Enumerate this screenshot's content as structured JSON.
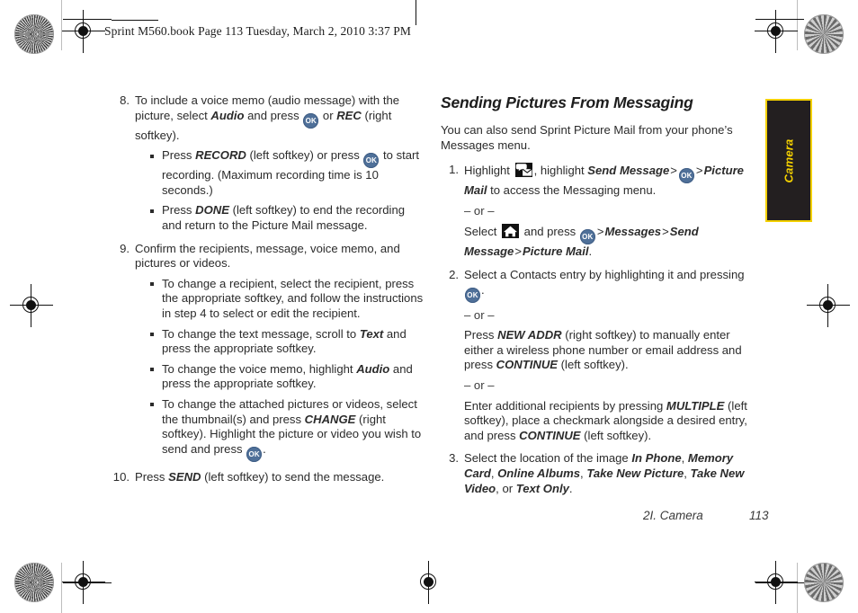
{
  "document": {
    "header_line": "Sprint M560.book  Page 113  Tuesday, March 2, 2010  3:37 PM",
    "footer_chapter": "2I. Camera",
    "footer_page": "113",
    "thumb_tab_label": "Camera",
    "accent_yellow": "#f3d000",
    "tab_background": "#231f20",
    "ok_key_color": "#4f7099"
  },
  "left_column": {
    "steps": [
      {
        "number": "8.",
        "segments": [
          {
            "t": "text",
            "v": "To include a voice memo (audio message) with the picture, select "
          },
          {
            "t": "kw",
            "v": "Audio"
          },
          {
            "t": "text",
            "v": " and press "
          },
          {
            "t": "okkey",
            "v": "OK"
          },
          {
            "t": "text",
            "v": " or "
          },
          {
            "t": "kw",
            "v": "REC"
          },
          {
            "t": "text",
            "v": " (right softkey)."
          }
        ],
        "bullets": [
          [
            {
              "t": "text",
              "v": "Press "
            },
            {
              "t": "kw",
              "v": "RECORD"
            },
            {
              "t": "text",
              "v": " (left softkey) or press "
            },
            {
              "t": "okkey",
              "v": "OK"
            },
            {
              "t": "text",
              "v": " to start recording. (Maximum recording time is 10 seconds.)"
            }
          ],
          [
            {
              "t": "text",
              "v": "Press "
            },
            {
              "t": "kw",
              "v": "DONE"
            },
            {
              "t": "text",
              "v": " (left softkey) to end the recording and return to the Picture Mail message."
            }
          ]
        ]
      },
      {
        "number": "9.",
        "segments": [
          {
            "t": "text",
            "v": "Confirm the recipients, message, voice memo, and pictures or videos."
          }
        ],
        "bullets": [
          [
            {
              "t": "text",
              "v": "To change a recipient, select the recipient, press the appropriate softkey, and follow the instructions in step 4 to select or edit the recipient."
            }
          ],
          [
            {
              "t": "text",
              "v": "To change the text message, scroll to "
            },
            {
              "t": "kw",
              "v": "Text"
            },
            {
              "t": "text",
              "v": " and press the appropriate softkey."
            }
          ],
          [
            {
              "t": "text",
              "v": "To change the voice memo, highlight "
            },
            {
              "t": "kw",
              "v": "Audio"
            },
            {
              "t": "text",
              "v": " and press the appropriate softkey."
            }
          ],
          [
            {
              "t": "text",
              "v": "To change the attached pictures or videos, select the thumbnail(s) and press "
            },
            {
              "t": "kw",
              "v": "CHANGE"
            },
            {
              "t": "text",
              "v": " (right softkey). Highlight the picture or video you wish to send and press "
            },
            {
              "t": "okkey",
              "v": "OK"
            },
            {
              "t": "text",
              "v": "."
            }
          ]
        ]
      },
      {
        "number": "10.",
        "segments": [
          {
            "t": "text",
            "v": "Press "
          },
          {
            "t": "kw",
            "v": "SEND"
          },
          {
            "t": "text",
            "v": " (left softkey) to send the message."
          }
        ],
        "bullets": []
      }
    ]
  },
  "right_column": {
    "section_title": "Sending Pictures From Messaging",
    "intro": "You can also send Sprint Picture Mail from your phone’s Messages menu.",
    "or_label": "– or –",
    "steps": [
      {
        "number": "1.",
        "segments": [
          {
            "t": "text",
            "v": "Highlight "
          },
          {
            "t": "icon",
            "v": "messaging-icon"
          },
          {
            "t": "text",
            "v": ", highlight "
          },
          {
            "t": "kw",
            "v": "Send Message"
          },
          {
            "t": "gt",
            "v": ">"
          },
          {
            "t": "okkey",
            "v": "OK"
          },
          {
            "t": "gt",
            "v": ">"
          },
          {
            "t": "kw",
            "v": "Picture Mail"
          },
          {
            "t": "text",
            "v": " to access the Messaging menu."
          }
        ],
        "alternatives": [
          [
            {
              "t": "text",
              "v": "Select "
            },
            {
              "t": "icon",
              "v": "home-icon"
            },
            {
              "t": "text",
              "v": " and press "
            },
            {
              "t": "okkey",
              "v": "OK"
            },
            {
              "t": "gt",
              "v": ">"
            },
            {
              "t": "kw",
              "v": "Messages"
            },
            {
              "t": "gt",
              "v": ">"
            },
            {
              "t": "kw",
              "v": "Send Message"
            },
            {
              "t": "gt",
              "v": ">"
            },
            {
              "t": "kw",
              "v": "Picture Mail"
            },
            {
              "t": "text",
              "v": "."
            }
          ]
        ]
      },
      {
        "number": "2.",
        "segments": [
          {
            "t": "text",
            "v": "Select a Contacts entry by highlighting it and pressing "
          },
          {
            "t": "okkey",
            "v": "OK"
          },
          {
            "t": "text",
            "v": "."
          }
        ],
        "alternatives": [
          [
            {
              "t": "text",
              "v": "Press "
            },
            {
              "t": "kw",
              "v": "NEW ADDR"
            },
            {
              "t": "text",
              "v": " (right softkey) to manually enter either a wireless phone number or email address and press "
            },
            {
              "t": "kw",
              "v": "CONTINUE"
            },
            {
              "t": "text",
              "v": " (left softkey)."
            }
          ],
          [
            {
              "t": "text",
              "v": "Enter additional recipients by pressing "
            },
            {
              "t": "kw",
              "v": "MULTIPLE"
            },
            {
              "t": "text",
              "v": " (left softkey), place a checkmark alongside a desired entry, and press "
            },
            {
              "t": "kw",
              "v": "CONTINUE"
            },
            {
              "t": "text",
              "v": " (left softkey)."
            }
          ]
        ]
      },
      {
        "number": "3.",
        "segments": [
          {
            "t": "text",
            "v": "Select the location of the image "
          },
          {
            "t": "kw",
            "v": "In Phone"
          },
          {
            "t": "text",
            "v": ", "
          },
          {
            "t": "kw",
            "v": "Memory Card"
          },
          {
            "t": "text",
            "v": ", "
          },
          {
            "t": "kw",
            "v": "Online Albums"
          },
          {
            "t": "text",
            "v": ", "
          },
          {
            "t": "kw",
            "v": "Take New Picture"
          },
          {
            "t": "text",
            "v": ", "
          },
          {
            "t": "kw",
            "v": "Take New Video"
          },
          {
            "t": "text",
            "v": ", or "
          },
          {
            "t": "kw",
            "v": "Text Only"
          },
          {
            "t": "text",
            "v": "."
          }
        ],
        "alternatives": []
      }
    ]
  }
}
